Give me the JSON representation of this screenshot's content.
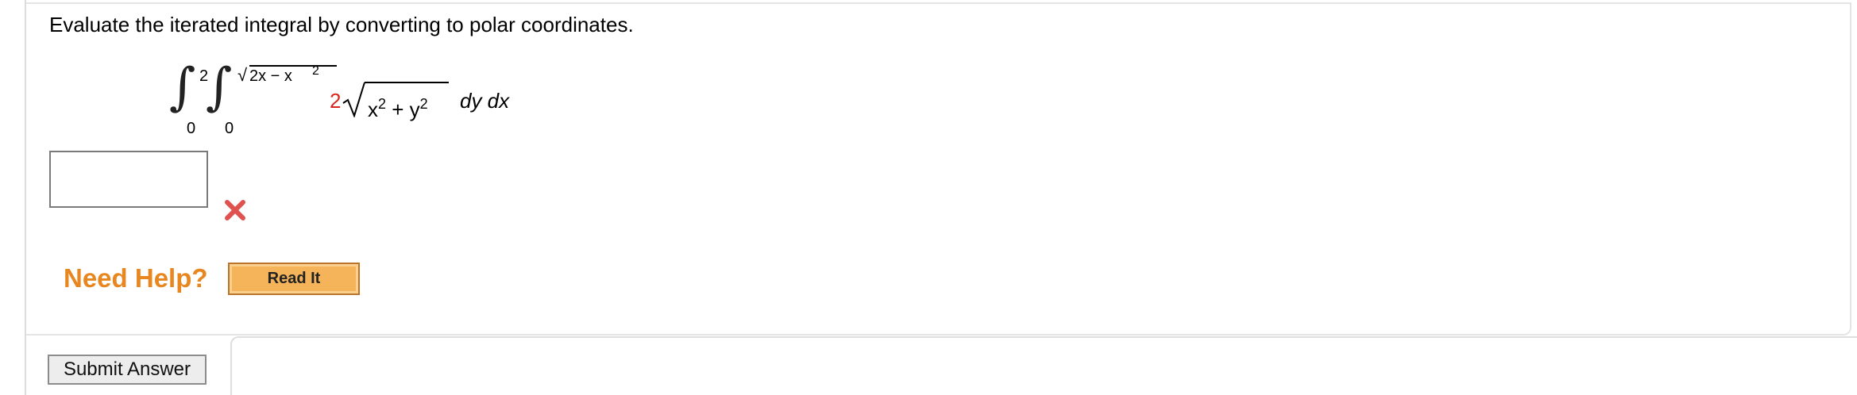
{
  "question": {
    "prompt": "Evaluate the iterated integral by converting to polar coordinates.",
    "integral": {
      "outer_lower": "0",
      "outer_upper": "2",
      "inner_lower": "0",
      "inner_upper_radicand": "2x − x",
      "inner_upper_exponent": "2",
      "coefficient": "2",
      "integrand_term1": "x",
      "integrand_exp1": "2",
      "integrand_plus": " + ",
      "integrand_term2": "y",
      "integrand_exp2": "2",
      "differentials": "dy dx"
    },
    "answer_value": "",
    "answer_status": "incorrect"
  },
  "help": {
    "label": "Need Help?",
    "read_it_label": "Read It"
  },
  "submit": {
    "label": "Submit Answer"
  },
  "colors": {
    "coefficient": "#d8261f",
    "help_text": "#e8861f",
    "read_it_bg": "#f6b45a",
    "wrong_mark": "#e0524f"
  }
}
